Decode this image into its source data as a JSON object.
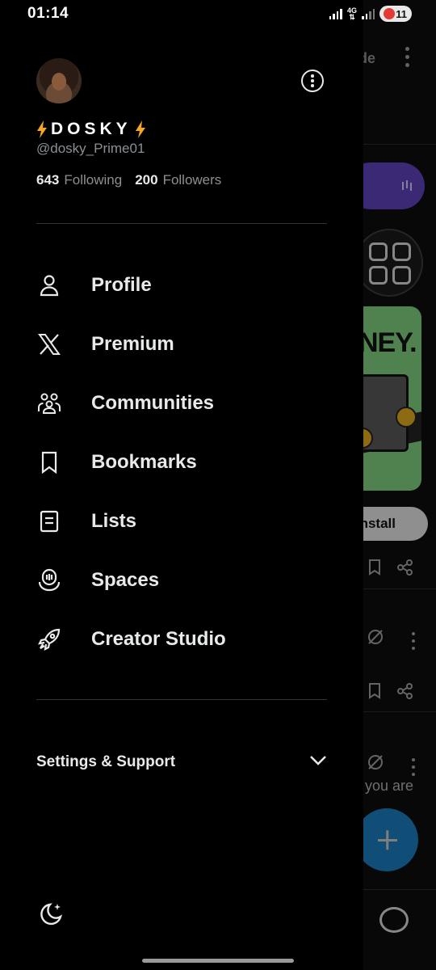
{
  "status_bar": {
    "time": "01:14",
    "network_label": "4G",
    "battery_level": "11"
  },
  "profile": {
    "display_name": "DOSKY",
    "handle": "@dosky_Prime01",
    "following_count": "643",
    "following_label": "Following",
    "followers_count": "200",
    "followers_label": "Followers",
    "avatar_icon": "avatar-photo",
    "more_icon": "more-options-icon"
  },
  "menu": {
    "items": [
      {
        "label": "Profile",
        "icon": "person-icon"
      },
      {
        "label": "Premium",
        "icon": "x-logo-icon"
      },
      {
        "label": "Communities",
        "icon": "people-icon"
      },
      {
        "label": "Bookmarks",
        "icon": "bookmark-icon"
      },
      {
        "label": "Lists",
        "icon": "list-icon"
      },
      {
        "label": "Spaces",
        "icon": "microphone-icon"
      },
      {
        "label": "Creator Studio",
        "icon": "rocket-icon"
      }
    ],
    "settings_label": "Settings & Support",
    "theme_icon": "moon-icon"
  },
  "background_feed": {
    "mode_text": "de",
    "ad_text": "NEY.",
    "install_label": "nstall",
    "tweet_text": "you are"
  },
  "colors": {
    "background": "#000000",
    "text_primary": "#e7e9ea",
    "text_secondary": "#8b8f94",
    "divider": "#2f3336",
    "accent_blue": "#1d9bf0",
    "bolt": "#f5a623"
  }
}
